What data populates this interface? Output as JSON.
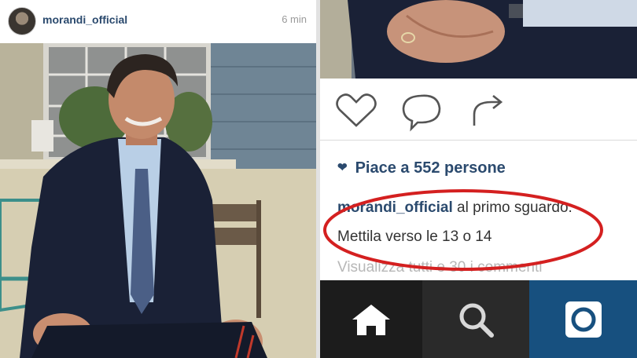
{
  "left_post": {
    "username": "morandi_official",
    "time": "6 min"
  },
  "right_post": {
    "likes_text": "Piace a 552 persone",
    "caption_user": "morandi_official",
    "caption_text": "al primo sguardo.",
    "caption_line2": "Mettila verso le 13 o 14",
    "view_comments": "Visualizza tutti e 30 i commenti",
    "annotation_color": "#d42020"
  },
  "icons": {
    "like": "heart-icon",
    "comment": "comment-bubble-icon",
    "share": "share-arrow-icon",
    "home": "home-icon",
    "search": "search-icon",
    "camera": "camera-icon"
  },
  "colors": {
    "link_blue": "#2b4a6e",
    "tab_active": "#17507f"
  }
}
